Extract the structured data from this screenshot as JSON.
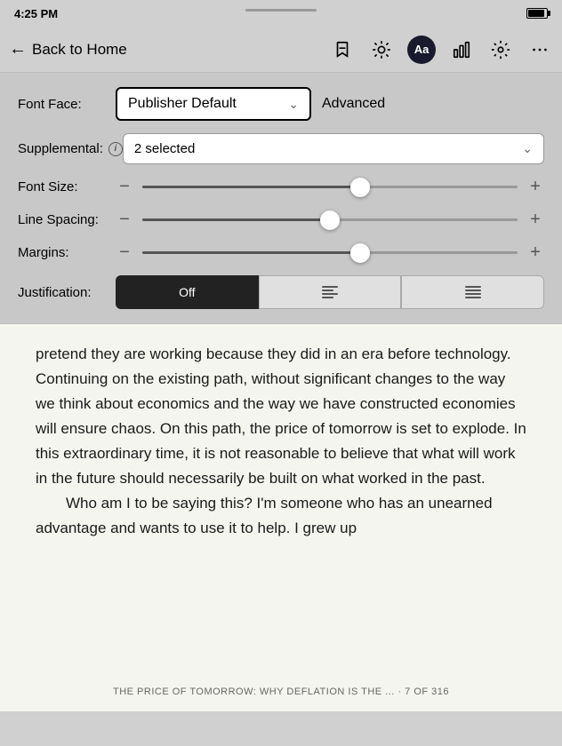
{
  "statusBar": {
    "time": "4:25 PM"
  },
  "navBar": {
    "backLabel": "Back to Home",
    "icons": {
      "bookmark": "bookmark-icon",
      "brightness": "brightness-icon",
      "font": "font-icon",
      "chart": "chart-icon",
      "settings": "settings-icon",
      "more": "more-icon"
    }
  },
  "settingsPanel": {
    "fontFaceLabel": "Font Face:",
    "fontFaceValue": "Publisher Default",
    "advancedLabel": "Advanced",
    "supplementalLabel": "Supplemental:",
    "supplementalValue": "2 selected",
    "fontSizeLabel": "Font Size:",
    "fontSizePercent": 58,
    "lineSpacingLabel": "Line Spacing:",
    "lineSpacingPercent": 50,
    "marginsLabel": "Margins:",
    "marginsPercent": 58,
    "justificationLabel": "Justification:",
    "justButtons": [
      "Off",
      "≡",
      "≡"
    ],
    "justActiveIndex": 0
  },
  "bookContent": {
    "paragraphs": [
      "pretend they are working because they did in an era before technology. Continuing on the existing path, without significant changes to the way we think about economics and the way we have constructed economies will ensure chaos. On this path, the price of tomorrow is set to explode. In this extraordinary time, it is not reasonable to believe that what will work in the future should necessarily be built on what worked in the past.",
      "Who am I to be saying this? I'm someone who has an unearned advantage and wants to use it to help. I grew up"
    ],
    "footer": "THE PRICE OF TOMORROW: WHY DEFLATION IS THE ... · 7 OF 316"
  }
}
